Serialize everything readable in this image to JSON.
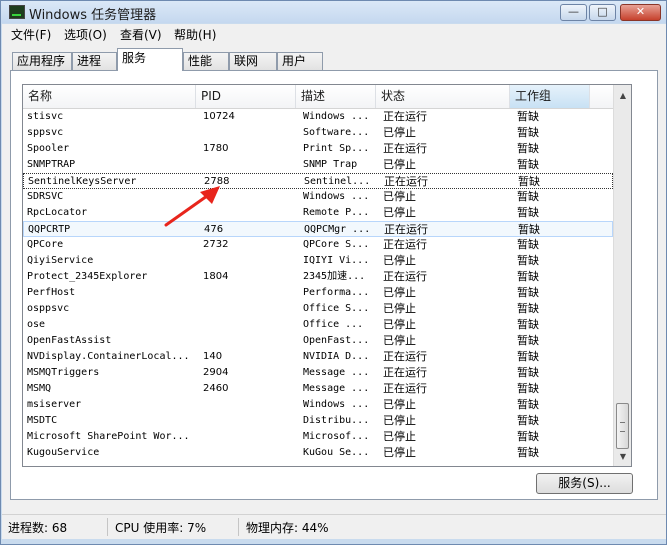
{
  "window": {
    "title": "Windows 任务管理器"
  },
  "titlebar_controls": {
    "minimize": "—",
    "maximize": "□",
    "close": "✕"
  },
  "menu": [
    "文件(F)",
    "选项(O)",
    "查看(V)",
    "帮助(H)"
  ],
  "tabs": [
    "应用程序",
    "进程",
    "服务",
    "性能",
    "联网",
    "用户"
  ],
  "active_tab": "服务",
  "columns": {
    "name": "名称",
    "pid": "PID",
    "desc": "描述",
    "status": "状态",
    "group": "工作组"
  },
  "sorted_column": "工作组",
  "services": [
    {
      "name": "stisvc",
      "pid": "10724",
      "desc": "Windows ...",
      "status": "正在运行",
      "group": "暂缺"
    },
    {
      "name": "sppsvc",
      "pid": "",
      "desc": "Software...",
      "status": "已停止",
      "group": "暂缺"
    },
    {
      "name": "Spooler",
      "pid": "1780",
      "desc": "Print Sp...",
      "status": "正在运行",
      "group": "暂缺"
    },
    {
      "name": "SNMPTRAP",
      "pid": "",
      "desc": "SNMP Trap",
      "status": "已停止",
      "group": "暂缺"
    },
    {
      "name": "SentinelKeysServer",
      "pid": "2788",
      "desc": "Sentinel...",
      "status": "正在运行",
      "group": "暂缺"
    },
    {
      "name": "SDRSVC",
      "pid": "",
      "desc": "Windows ...",
      "status": "已停止",
      "group": "暂缺"
    },
    {
      "name": "RpcLocator",
      "pid": "",
      "desc": "Remote P...",
      "status": "已停止",
      "group": "暂缺"
    },
    {
      "name": "QQPCRTP",
      "pid": "476",
      "desc": "QQPCMgr ...",
      "status": "正在运行",
      "group": "暂缺"
    },
    {
      "name": "QPCore",
      "pid": "2732",
      "desc": "QPCore S...",
      "status": "正在运行",
      "group": "暂缺"
    },
    {
      "name": "QiyiService",
      "pid": "",
      "desc": "IQIYI Vi...",
      "status": "已停止",
      "group": "暂缺"
    },
    {
      "name": "Protect_2345Explorer",
      "pid": "1804",
      "desc": "2345加速...",
      "status": "正在运行",
      "group": "暂缺"
    },
    {
      "name": "PerfHost",
      "pid": "",
      "desc": "Performa...",
      "status": "已停止",
      "group": "暂缺"
    },
    {
      "name": "osppsvc",
      "pid": "",
      "desc": "Office S...",
      "status": "已停止",
      "group": "暂缺"
    },
    {
      "name": "ose",
      "pid": "",
      "desc": "Office ...",
      "status": "已停止",
      "group": "暂缺"
    },
    {
      "name": "OpenFastAssist",
      "pid": "",
      "desc": "OpenFast...",
      "status": "已停止",
      "group": "暂缺"
    },
    {
      "name": "NVDisplay.ContainerLocal...",
      "pid": "140",
      "desc": "NVIDIA D...",
      "status": "正在运行",
      "group": "暂缺"
    },
    {
      "name": "MSMQTriggers",
      "pid": "2904",
      "desc": "Message ...",
      "status": "正在运行",
      "group": "暂缺"
    },
    {
      "name": "MSMQ",
      "pid": "2460",
      "desc": "Message ...",
      "status": "正在运行",
      "group": "暂缺"
    },
    {
      "name": "msiserver",
      "pid": "",
      "desc": "Windows ...",
      "status": "已停止",
      "group": "暂缺"
    },
    {
      "name": "MSDTC",
      "pid": "",
      "desc": "Distribu...",
      "status": "已停止",
      "group": "暂缺"
    },
    {
      "name": "Microsoft SharePoint Wor...",
      "pid": "",
      "desc": "Microsof...",
      "status": "已停止",
      "group": "暂缺"
    },
    {
      "name": "KugouService",
      "pid": "",
      "desc": "KuGou Se...",
      "status": "已停止",
      "group": "暂缺"
    }
  ],
  "focused_row": "SentinelKeysServer",
  "hover_row": "QQPCRTP",
  "services_button": "服务(S)...",
  "statusbar": {
    "processes": "进程数: 68",
    "cpu": "CPU 使用率: 7%",
    "memory": "物理内存: 44%"
  },
  "colors": {
    "annotation_arrow": "#e8251c",
    "selection_border": "#b8d6fb",
    "titlebar": "#c5d8ef",
    "close_button": "#c6412c"
  },
  "icons": {
    "app": "task-manager-icon",
    "scroll_up": "scroll-up-arrow-icon",
    "scroll_down": "scroll-down-arrow-icon",
    "annotation": "red-pointer-arrow-icon"
  }
}
